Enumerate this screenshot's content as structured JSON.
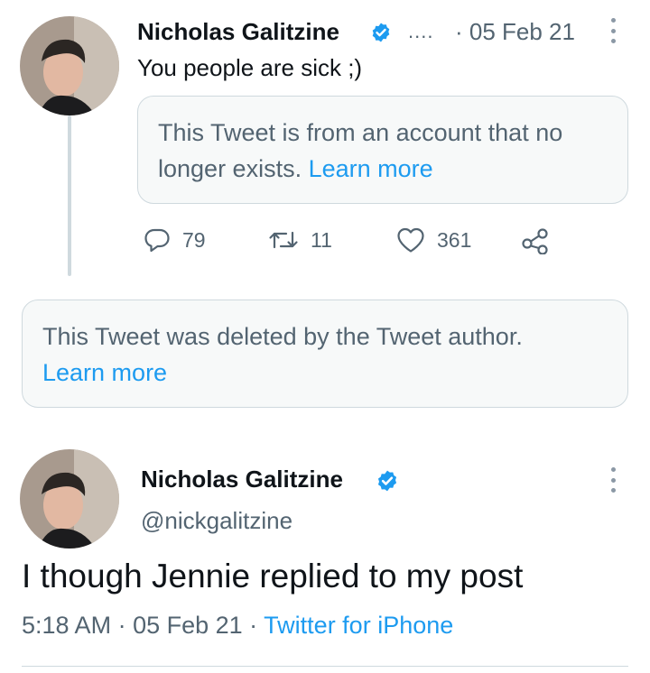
{
  "tweet1": {
    "author_name": "Nicholas Galitzine",
    "ellipsis": "....",
    "date": "· 05 Feb 21",
    "text": "You people are sick ;)",
    "quoted_notice": {
      "text": "This Tweet is from an account that no longer exists.",
      "link": "Learn more"
    },
    "actions": {
      "replies": "79",
      "retweets": "11",
      "likes": "361"
    }
  },
  "deleted_notice": {
    "text": "This Tweet was deleted by the Tweet author.",
    "link": "Learn more"
  },
  "tweet2": {
    "author_name": "Nicholas Galitzine",
    "handle": "@nickgalitzine",
    "text": "I though Jennie replied to my post",
    "time": "5:18 AM",
    "separator1": " · ",
    "date": "05 Feb 21",
    "separator2": " · ",
    "source": "Twitter for iPhone"
  },
  "icons": {
    "verified": "verified-badge-icon",
    "reply": "reply-icon",
    "retweet": "retweet-icon",
    "like": "heart-icon",
    "share": "share-icon",
    "more": "more-vertical-icon"
  },
  "colors": {
    "accent": "#1d9bf0",
    "muted": "#536471",
    "text": "#0f1419",
    "border": "#cfd9de"
  }
}
